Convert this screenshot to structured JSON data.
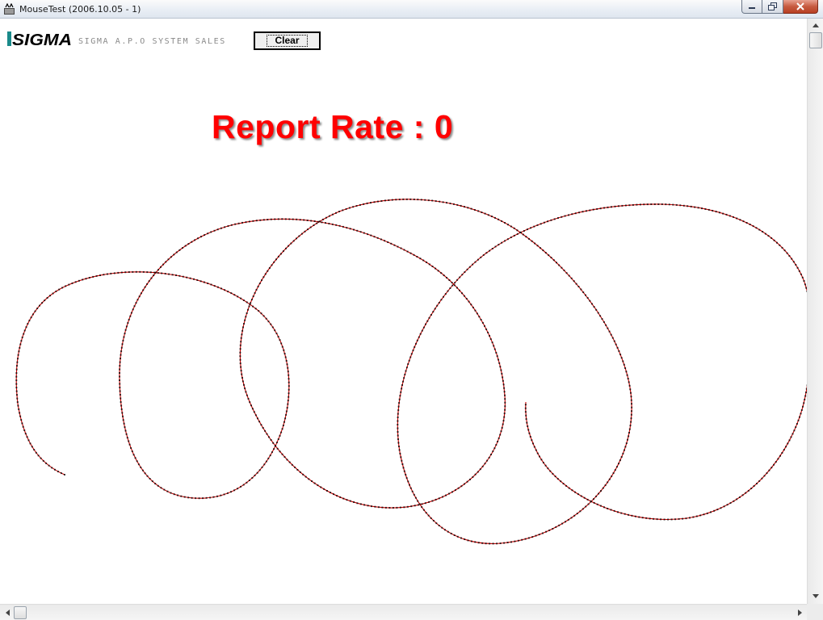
{
  "window": {
    "title": "MouseTest (2006.10.05 - 1)",
    "app_icon": "mouse-test-app-icon",
    "buttons": {
      "minimize": "minimize-icon",
      "maximize": "maximize-icon",
      "close": "close-icon"
    }
  },
  "header": {
    "logo_text": "SIGMA",
    "tagline": "SIGMA A.P.O SYSTEM SALES",
    "clear_label": "Clear"
  },
  "report": {
    "label": "Report Rate : ",
    "value": "0",
    "text": "Report Rate : 0",
    "color": "#ff0000"
  },
  "trail": {
    "stroke_color": "#cc0000",
    "dot_color": "#000000"
  },
  "colors": {
    "logo_teal": "#1a8a8a",
    "logo_dark": "#000000"
  }
}
